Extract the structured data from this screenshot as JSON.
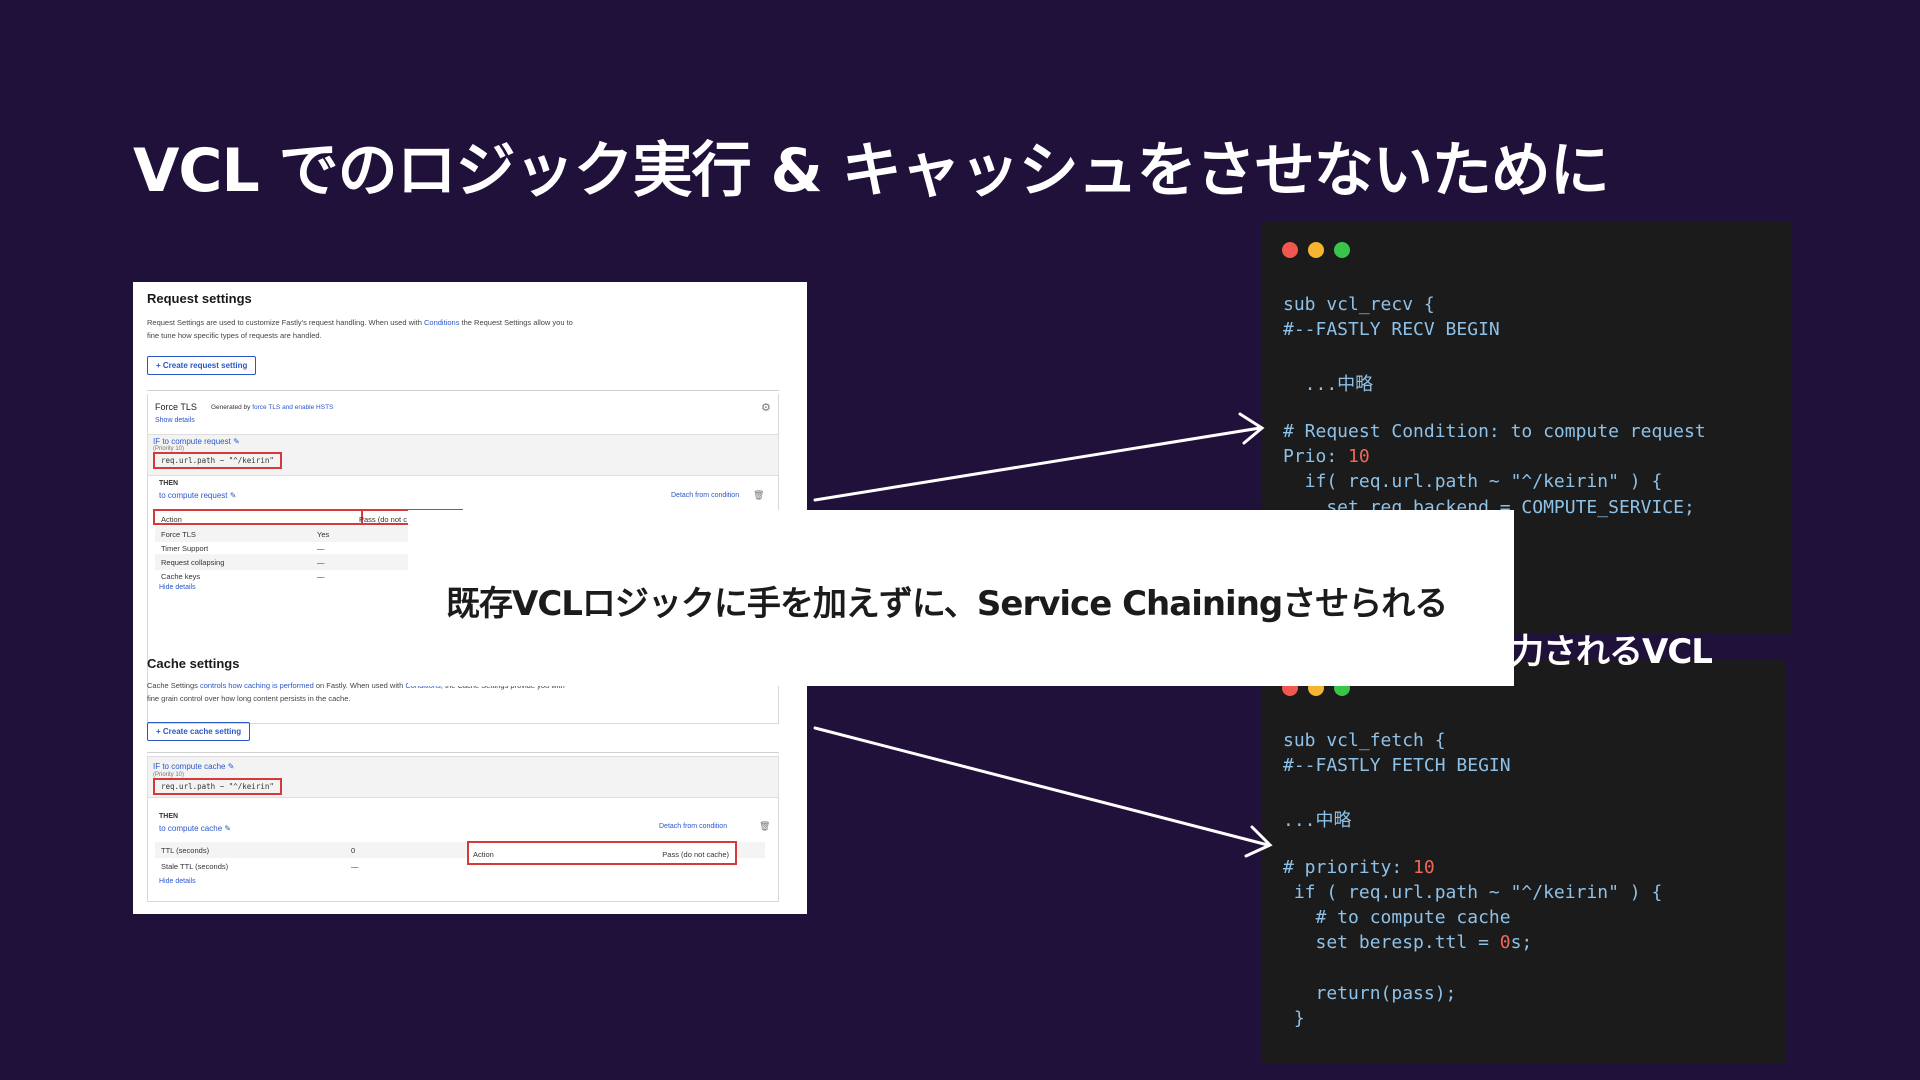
{
  "slide": {
    "title": "VCL でのロジック実行 & キャッシュをさせないために",
    "overlay_text": "既存VCLロジックに手を加えずに、Service Chainingさせられる",
    "caption_partial": "力されるVCL"
  },
  "request_settings": {
    "heading": "Request settings",
    "description_1": "Request Settings are used to customize Fastly's request handling. When used with ",
    "description_link": "Conditions",
    "description_2": " the Request Settings allow you to",
    "description_3": "fine tune how specific types of requests are handled.",
    "create_button": "+ Create request setting",
    "force_tls": {
      "name": "Force TLS",
      "generated_by": "Generated by",
      "generated_link": "force TLS and enable HSTS",
      "show_details": "Show details"
    },
    "condition": {
      "if_label": "IF to compute request",
      "priority": "(Priority 10)",
      "expression": "req.url.path ~ \"^/keirin\""
    },
    "then": {
      "label": "THEN",
      "name": "to compute request",
      "detach": "Detach from condition",
      "rows": [
        {
          "key": "Action",
          "value": "Pass (do not c"
        },
        {
          "key": "Force TLS",
          "value": "Yes"
        },
        {
          "key": "Timer Support",
          "value": "—"
        },
        {
          "key": "Request collapsing",
          "value": "—"
        },
        {
          "key": "Cache keys",
          "value": "—"
        }
      ],
      "hide_details": "Hide details"
    }
  },
  "cache_settings": {
    "heading": "Cache settings",
    "description_1": "Cache Settings ",
    "description_link": "controls how caching is performed",
    "description_2": " on Fastly. When used with ",
    "description_link2": "Conditions",
    "description_3": ", the Cache Settings provide you with",
    "description_4": "fine grain control over how long content persists in the cache.",
    "create_button": "+ Create cache setting",
    "condition": {
      "if_label": "IF to compute cache",
      "priority": "(Priority 10)",
      "expression": "req.url.path ~ \"^/keirin\""
    },
    "then": {
      "label": "THEN",
      "name": "to compute cache",
      "detach": "Detach from condition",
      "rows": [
        {
          "key": "TTL (seconds)",
          "value": "0"
        },
        {
          "key": "Stale TTL (seconds)",
          "value": "—"
        }
      ],
      "action_key": "Action",
      "action_value": "Pass (do not cache)",
      "hide_details": "Hide details"
    }
  },
  "code_recv": {
    "lines": [
      "sub vcl_recv {",
      "#--FASTLY RECV BEGIN",
      "",
      "  ...中略",
      "",
      "# Request Condition: to compute request",
      "Prio: 10",
      "  if( req.url.path ~ \"^/keirin\" ) {",
      "    set req.backend = COMPUTE_SERVICE;"
    ]
  },
  "code_fetch": {
    "lines": [
      "sub vcl_fetch {",
      "#--FASTLY FETCH BEGIN",
      "",
      "...中略",
      "",
      "# priority: 10",
      " if ( req.url.path ~ \"^/keirin\" ) {",
      "   # to compute cache",
      "   set beresp.ttl = 0s;",
      "",
      "   return(pass);",
      " }"
    ]
  },
  "colors": {
    "background": "#20113a",
    "code_bg": "#1b1b1b",
    "accent_red": "#d43a3a",
    "link_blue": "#2b57c9"
  }
}
